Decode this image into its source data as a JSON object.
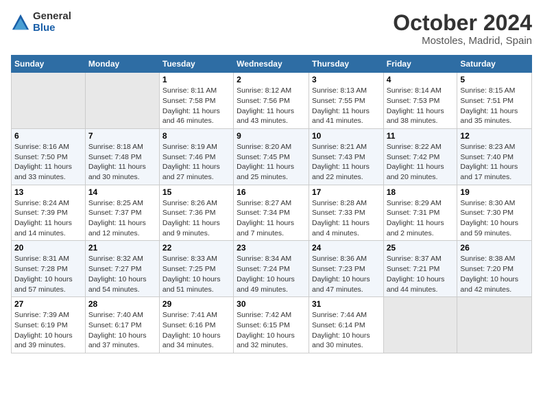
{
  "header": {
    "logo_general": "General",
    "logo_blue": "Blue",
    "month": "October 2024",
    "location": "Mostoles, Madrid, Spain"
  },
  "weekdays": [
    "Sunday",
    "Monday",
    "Tuesday",
    "Wednesday",
    "Thursday",
    "Friday",
    "Saturday"
  ],
  "weeks": [
    [
      {
        "day": "",
        "info": ""
      },
      {
        "day": "",
        "info": ""
      },
      {
        "day": "1",
        "info": "Sunrise: 8:11 AM\nSunset: 7:58 PM\nDaylight: 11 hours and 46 minutes."
      },
      {
        "day": "2",
        "info": "Sunrise: 8:12 AM\nSunset: 7:56 PM\nDaylight: 11 hours and 43 minutes."
      },
      {
        "day": "3",
        "info": "Sunrise: 8:13 AM\nSunset: 7:55 PM\nDaylight: 11 hours and 41 minutes."
      },
      {
        "day": "4",
        "info": "Sunrise: 8:14 AM\nSunset: 7:53 PM\nDaylight: 11 hours and 38 minutes."
      },
      {
        "day": "5",
        "info": "Sunrise: 8:15 AM\nSunset: 7:51 PM\nDaylight: 11 hours and 35 minutes."
      }
    ],
    [
      {
        "day": "6",
        "info": "Sunrise: 8:16 AM\nSunset: 7:50 PM\nDaylight: 11 hours and 33 minutes."
      },
      {
        "day": "7",
        "info": "Sunrise: 8:18 AM\nSunset: 7:48 PM\nDaylight: 11 hours and 30 minutes."
      },
      {
        "day": "8",
        "info": "Sunrise: 8:19 AM\nSunset: 7:46 PM\nDaylight: 11 hours and 27 minutes."
      },
      {
        "day": "9",
        "info": "Sunrise: 8:20 AM\nSunset: 7:45 PM\nDaylight: 11 hours and 25 minutes."
      },
      {
        "day": "10",
        "info": "Sunrise: 8:21 AM\nSunset: 7:43 PM\nDaylight: 11 hours and 22 minutes."
      },
      {
        "day": "11",
        "info": "Sunrise: 8:22 AM\nSunset: 7:42 PM\nDaylight: 11 hours and 20 minutes."
      },
      {
        "day": "12",
        "info": "Sunrise: 8:23 AM\nSunset: 7:40 PM\nDaylight: 11 hours and 17 minutes."
      }
    ],
    [
      {
        "day": "13",
        "info": "Sunrise: 8:24 AM\nSunset: 7:39 PM\nDaylight: 11 hours and 14 minutes."
      },
      {
        "day": "14",
        "info": "Sunrise: 8:25 AM\nSunset: 7:37 PM\nDaylight: 11 hours and 12 minutes."
      },
      {
        "day": "15",
        "info": "Sunrise: 8:26 AM\nSunset: 7:36 PM\nDaylight: 11 hours and 9 minutes."
      },
      {
        "day": "16",
        "info": "Sunrise: 8:27 AM\nSunset: 7:34 PM\nDaylight: 11 hours and 7 minutes."
      },
      {
        "day": "17",
        "info": "Sunrise: 8:28 AM\nSunset: 7:33 PM\nDaylight: 11 hours and 4 minutes."
      },
      {
        "day": "18",
        "info": "Sunrise: 8:29 AM\nSunset: 7:31 PM\nDaylight: 11 hours and 2 minutes."
      },
      {
        "day": "19",
        "info": "Sunrise: 8:30 AM\nSunset: 7:30 PM\nDaylight: 10 hours and 59 minutes."
      }
    ],
    [
      {
        "day": "20",
        "info": "Sunrise: 8:31 AM\nSunset: 7:28 PM\nDaylight: 10 hours and 57 minutes."
      },
      {
        "day": "21",
        "info": "Sunrise: 8:32 AM\nSunset: 7:27 PM\nDaylight: 10 hours and 54 minutes."
      },
      {
        "day": "22",
        "info": "Sunrise: 8:33 AM\nSunset: 7:25 PM\nDaylight: 10 hours and 51 minutes."
      },
      {
        "day": "23",
        "info": "Sunrise: 8:34 AM\nSunset: 7:24 PM\nDaylight: 10 hours and 49 minutes."
      },
      {
        "day": "24",
        "info": "Sunrise: 8:36 AM\nSunset: 7:23 PM\nDaylight: 10 hours and 47 minutes."
      },
      {
        "day": "25",
        "info": "Sunrise: 8:37 AM\nSunset: 7:21 PM\nDaylight: 10 hours and 44 minutes."
      },
      {
        "day": "26",
        "info": "Sunrise: 8:38 AM\nSunset: 7:20 PM\nDaylight: 10 hours and 42 minutes."
      }
    ],
    [
      {
        "day": "27",
        "info": "Sunrise: 7:39 AM\nSunset: 6:19 PM\nDaylight: 10 hours and 39 minutes."
      },
      {
        "day": "28",
        "info": "Sunrise: 7:40 AM\nSunset: 6:17 PM\nDaylight: 10 hours and 37 minutes."
      },
      {
        "day": "29",
        "info": "Sunrise: 7:41 AM\nSunset: 6:16 PM\nDaylight: 10 hours and 34 minutes."
      },
      {
        "day": "30",
        "info": "Sunrise: 7:42 AM\nSunset: 6:15 PM\nDaylight: 10 hours and 32 minutes."
      },
      {
        "day": "31",
        "info": "Sunrise: 7:44 AM\nSunset: 6:14 PM\nDaylight: 10 hours and 30 minutes."
      },
      {
        "day": "",
        "info": ""
      },
      {
        "day": "",
        "info": ""
      }
    ]
  ]
}
